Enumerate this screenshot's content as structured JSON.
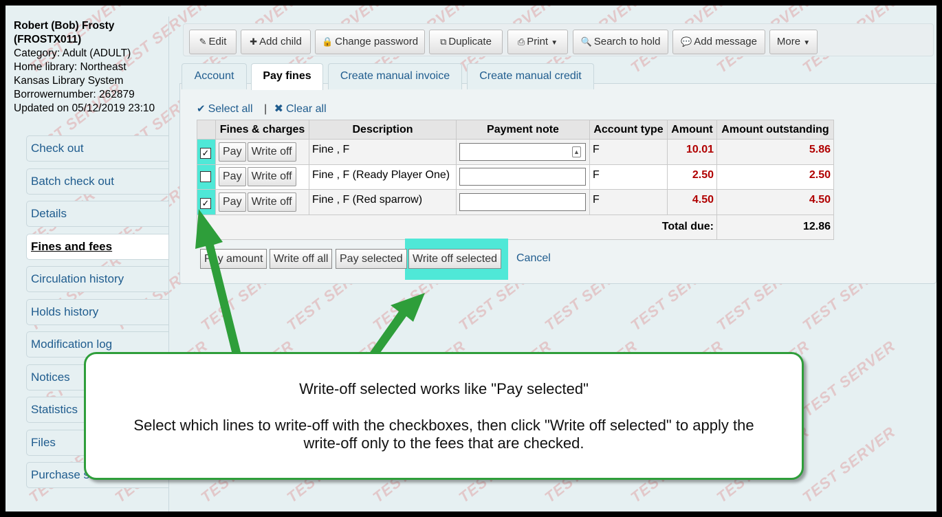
{
  "patron": {
    "name_line1": "Robert (Bob) Frosty",
    "name_line2": "(FROSTX011)",
    "category": "Category: Adult (ADULT)",
    "home_library_1": "Home library: Northeast",
    "home_library_2": "Kansas Library System",
    "borrowernumber": "Borrowernumber: 262879",
    "updated": "Updated on 05/12/2019 23:10"
  },
  "sidebar": {
    "items": [
      {
        "label": "Check out"
      },
      {
        "label": "Batch check out"
      },
      {
        "label": "Details"
      },
      {
        "label": "Fines and fees"
      },
      {
        "label": "Circulation history"
      },
      {
        "label": "Holds history"
      },
      {
        "label": "Modification log"
      },
      {
        "label": "Notices"
      },
      {
        "label": "Statistics"
      },
      {
        "label": "Files"
      },
      {
        "label": "Purchase s"
      }
    ],
    "active": "Fines and fees"
  },
  "toolbar": {
    "edit": "Edit",
    "add_child": "Add child",
    "change_password": "Change password",
    "duplicate": "Duplicate",
    "print": "Print",
    "search_to_hold": "Search to hold",
    "add_message": "Add message",
    "more": "More"
  },
  "tabs": [
    "Account",
    "Pay fines",
    "Create manual invoice",
    "Create manual credit"
  ],
  "active_tab": "Pay fines",
  "select_all": "Select all",
  "clear_all": "Clear all",
  "table": {
    "headers": [
      "",
      "Fines & charges",
      "Description",
      "Payment note",
      "Account type",
      "Amount",
      "Amount outstanding"
    ],
    "rows": [
      {
        "checked": true,
        "pay": "Pay",
        "write_off": "Write off",
        "description": "Fine , F",
        "account_type": "F",
        "amount": "10.01",
        "outstanding": "5.86"
      },
      {
        "checked": false,
        "pay": "Pay",
        "write_off": "Write off",
        "description": "Fine , F (Ready Player One)",
        "account_type": "F",
        "amount": "2.50",
        "outstanding": "2.50"
      },
      {
        "checked": true,
        "pay": "Pay",
        "write_off": "Write off",
        "description": "Fine , F (Red sparrow)",
        "account_type": "F",
        "amount": "4.50",
        "outstanding": "4.50"
      }
    ],
    "total_label": "Total due:",
    "total_value": "12.86"
  },
  "actions": {
    "pay_amount": "Pay amount",
    "write_off_all": "Write off all",
    "pay_selected": "Pay selected",
    "write_off_selected": "Write off selected",
    "cancel": "Cancel"
  },
  "callout": {
    "title": "Write-off selected works like \"Pay selected\"",
    "body": "Select which lines to write-off with the checkboxes, then click \"Write off selected\" to apply the write-off only to the fees that are checked."
  },
  "watermark": "TEST SERVER",
  "colors": {
    "link": "#1f5c8e",
    "amount_red": "#b00000",
    "highlight": "#4fe8d7",
    "arrow_green": "#2e9e3a"
  }
}
